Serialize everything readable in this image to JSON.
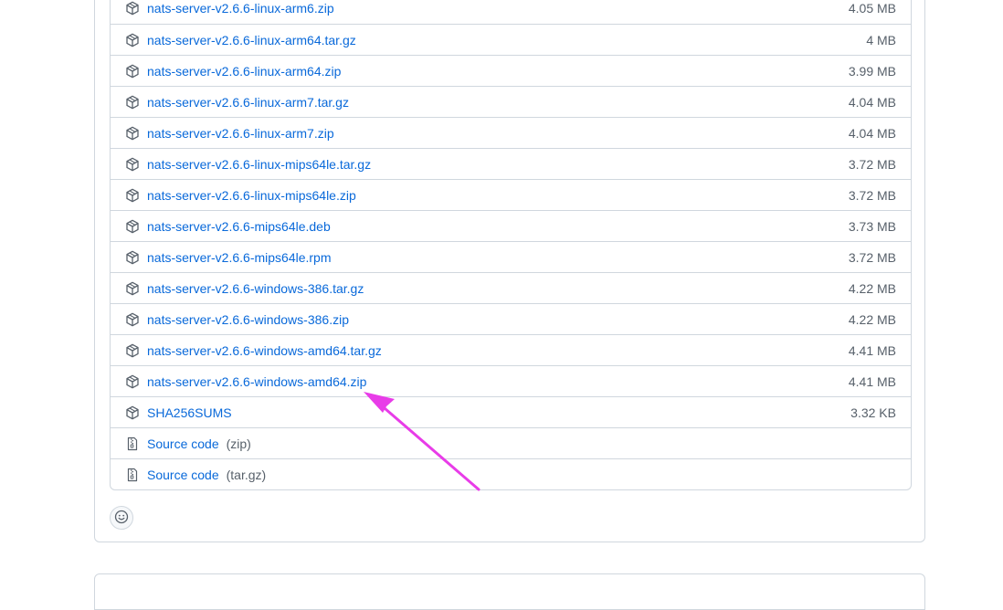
{
  "assets": [
    {
      "name": "nats-server-v2.6.6-linux-arm6.zip",
      "size": "4.05 MB",
      "icon": "package-icon"
    },
    {
      "name": "nats-server-v2.6.6-linux-arm64.tar.gz",
      "size": "4 MB",
      "icon": "package-icon"
    },
    {
      "name": "nats-server-v2.6.6-linux-arm64.zip",
      "size": "3.99 MB",
      "icon": "package-icon"
    },
    {
      "name": "nats-server-v2.6.6-linux-arm7.tar.gz",
      "size": "4.04 MB",
      "icon": "package-icon"
    },
    {
      "name": "nats-server-v2.6.6-linux-arm7.zip",
      "size": "4.04 MB",
      "icon": "package-icon"
    },
    {
      "name": "nats-server-v2.6.6-linux-mips64le.tar.gz",
      "size": "3.72 MB",
      "icon": "package-icon"
    },
    {
      "name": "nats-server-v2.6.6-linux-mips64le.zip",
      "size": "3.72 MB",
      "icon": "package-icon"
    },
    {
      "name": "nats-server-v2.6.6-mips64le.deb",
      "size": "3.73 MB",
      "icon": "package-icon"
    },
    {
      "name": "nats-server-v2.6.6-mips64le.rpm",
      "size": "3.72 MB",
      "icon": "package-icon"
    },
    {
      "name": "nats-server-v2.6.6-windows-386.tar.gz",
      "size": "4.22 MB",
      "icon": "package-icon"
    },
    {
      "name": "nats-server-v2.6.6-windows-386.zip",
      "size": "4.22 MB",
      "icon": "package-icon"
    },
    {
      "name": "nats-server-v2.6.6-windows-amd64.tar.gz",
      "size": "4.41 MB",
      "icon": "package-icon"
    },
    {
      "name": "nats-server-v2.6.6-windows-amd64.zip",
      "size": "4.41 MB",
      "icon": "package-icon"
    },
    {
      "name": "SHA256SUMS",
      "size": "3.32 KB",
      "icon": "package-icon"
    }
  ],
  "source_code": [
    {
      "name": "Source code",
      "suffix": "(zip)",
      "icon": "file-zip-icon"
    },
    {
      "name": "Source code",
      "suffix": "(tar.gz)",
      "icon": "file-zip-icon"
    }
  ],
  "reaction": {
    "icon": "smiley-icon"
  },
  "colors": {
    "link": "#0969da",
    "muted": "#57606a",
    "border": "#d0d7de",
    "annotation_arrow": "#e83ce8"
  }
}
